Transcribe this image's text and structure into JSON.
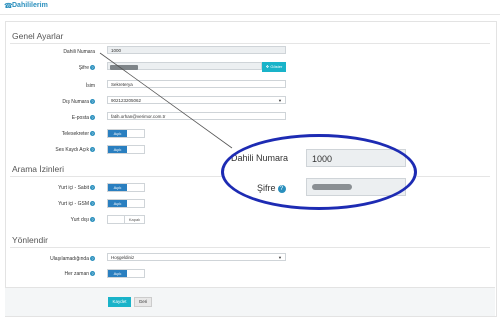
{
  "header": {
    "icon": "phone-icon",
    "title": "Dahililerim"
  },
  "sections": {
    "general": "Genel Ayarlar",
    "permissions": "Arama İzinleri",
    "routing": "Yönlendir"
  },
  "general": {
    "extension_label": "Dahili Numara",
    "extension_value": "1000",
    "password_label": "Şifre",
    "show_button": "❖ Göster",
    "name_label": "İsim",
    "name_value": "Sekreterya",
    "ext_number_label": "Dış Numara",
    "ext_number_value": "902123205062",
    "email_label": "E-posta",
    "email_value": "fatih.orhan@verimor.com.tr",
    "voicemail_label": "Telesekreter",
    "voicemail_state": "Açık",
    "recording_label": "Ses Kaydı Açık",
    "recording_state": "Açık"
  },
  "permissions": {
    "domestic_fixed_label": "Yurt içi - Sabit",
    "domestic_fixed_state": "Açık",
    "domestic_gsm_label": "Yurt içi - GSM",
    "domestic_gsm_state": "Açık",
    "international_label": "Yurt dışı",
    "international_state": "Kapalı"
  },
  "routing": {
    "unreachable_label": "Ulaşılamadığında",
    "unreachable_value": "Hoşgeldiniz",
    "always_label": "Her zaman",
    "always_state": "Açık"
  },
  "footer": {
    "save": "Kaydet",
    "back": "Geri"
  },
  "zoom": {
    "extension_label": "Dahili Numara",
    "extension_value": "1000",
    "password_label": "Şifre"
  },
  "colors": {
    "accent": "#19b3c9",
    "toggle_on": "#2a7fc0",
    "highlight": "#1d2bb3"
  }
}
